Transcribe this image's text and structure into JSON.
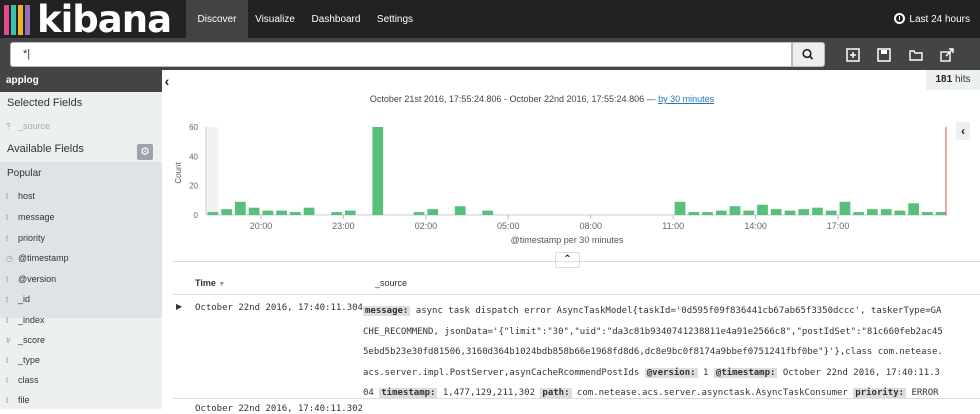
{
  "app": {
    "logo_text": "kibana",
    "logo_colors": [
      "#e8488b",
      "#3cbeb1",
      "#f0b324",
      "#9170b8"
    ]
  },
  "nav": {
    "items": [
      {
        "label": "Discover",
        "active": true
      },
      {
        "label": "Visualize"
      },
      {
        "label": "Dashboard"
      },
      {
        "label": "Settings"
      }
    ]
  },
  "time_picker": {
    "label": "Last 24 hours",
    "icon": "clock-icon"
  },
  "search": {
    "value": "*|",
    "button_icon": "search-icon"
  },
  "toolbar": {
    "icons": [
      "new-search-icon",
      "save-search-icon",
      "open-search-icon",
      "share-icon"
    ]
  },
  "sidebar": {
    "index_pattern": "applog",
    "selected_heading": "Selected Fields",
    "selected_fields": [
      {
        "type": "?",
        "name": "_source"
      }
    ],
    "available_heading": "Available Fields",
    "popular_label": "Popular",
    "popular_fields": [
      {
        "type": "t",
        "name": "host"
      },
      {
        "type": "t",
        "name": "message"
      },
      {
        "type": "t",
        "name": "priority"
      }
    ],
    "other_fields": [
      {
        "type": "clock",
        "name": "@timestamp"
      },
      {
        "type": "t",
        "name": "@version"
      },
      {
        "type": "t",
        "name": "_id"
      },
      {
        "type": "t",
        "name": "_index"
      },
      {
        "type": "#",
        "name": "_score"
      },
      {
        "type": "t",
        "name": "_type"
      },
      {
        "type": "t",
        "name": "class"
      },
      {
        "type": "t",
        "name": "file"
      }
    ]
  },
  "hits": {
    "count": "181",
    "label": "hits"
  },
  "range": {
    "text": "October 21st 2016, 17:55:24.806 - October 22nd 2016, 17:55:24.806 — ",
    "link": "by 30 minutes"
  },
  "chart_data": {
    "type": "bar",
    "xlabel": "@timestamp per 30 minutes",
    "ylabel": "Count",
    "ylim": [
      0,
      60
    ],
    "yticks": [
      0,
      20,
      40,
      60
    ],
    "x_tick_labels": [
      "20:00",
      "23:00",
      "02:00",
      "05:00",
      "08:00",
      "11:00",
      "14:00",
      "17:00"
    ],
    "bar_color": "#57c17b",
    "values": [
      2,
      4,
      9,
      5,
      3,
      3,
      2,
      5,
      0,
      2,
      3,
      0,
      60,
      0,
      0,
      2,
      4,
      0,
      6,
      0,
      3,
      0,
      0,
      0,
      0,
      0,
      0,
      0,
      0,
      0,
      0,
      0,
      0,
      0,
      9,
      2,
      2,
      3,
      6,
      3,
      7,
      4,
      3,
      4,
      5,
      3,
      9,
      2,
      4,
      4,
      3,
      8,
      2,
      2
    ],
    "bucket_start": "18:00",
    "bucket_minutes": 30,
    "current_time_marker": "17:55"
  },
  "table": {
    "columns": {
      "time": "Time",
      "source": "_source"
    },
    "rows": [
      {
        "time": "October 22nd 2016, 17:40:11.304",
        "lines": [
          [
            {
              "k": "message:"
            },
            {
              "v": " async task dispatch error AsyncTaskModel{taskId='0d595f09f836441cb67ab65f3350dccc', taskerType=GA"
            }
          ],
          [
            {
              "v": "CHE_RECOMMEND, jsonData='{\"limit\":\"30\",\"uid\":\"da3c81b9340741238811e4a91e2566c8\",\"postIdSet\":\"81c660feb2ac45"
            }
          ],
          [
            {
              "v": "5ebd5b23e30fd81506,3160d364b1024bdb858b66e1968fd8d6,dc8e9bc0f8174a9bbef0751241fbf0be\"}'},class com.netease."
            }
          ],
          [
            {
              "v": "acs.server.impl.PostServer,asynCacheRcommendPostIds "
            },
            {
              "k": "@version:"
            },
            {
              "v": " 1 "
            },
            {
              "k": "@timestamp:"
            },
            {
              "v": " October 22nd 2016, 17:40:11.3"
            }
          ],
          [
            {
              "v": "04 "
            },
            {
              "k": "timestamp:"
            },
            {
              "v": " 1,477,129,211,302 "
            },
            {
              "k": "path:"
            },
            {
              "v": " com.netease.acs.server.asynctask.AsyncTaskConsumer "
            },
            {
              "k": "priority:"
            },
            {
              "v": " ERROR"
            }
          ]
        ]
      },
      {
        "time": "October 22nd 2016, 17:40:11.302"
      }
    ]
  }
}
